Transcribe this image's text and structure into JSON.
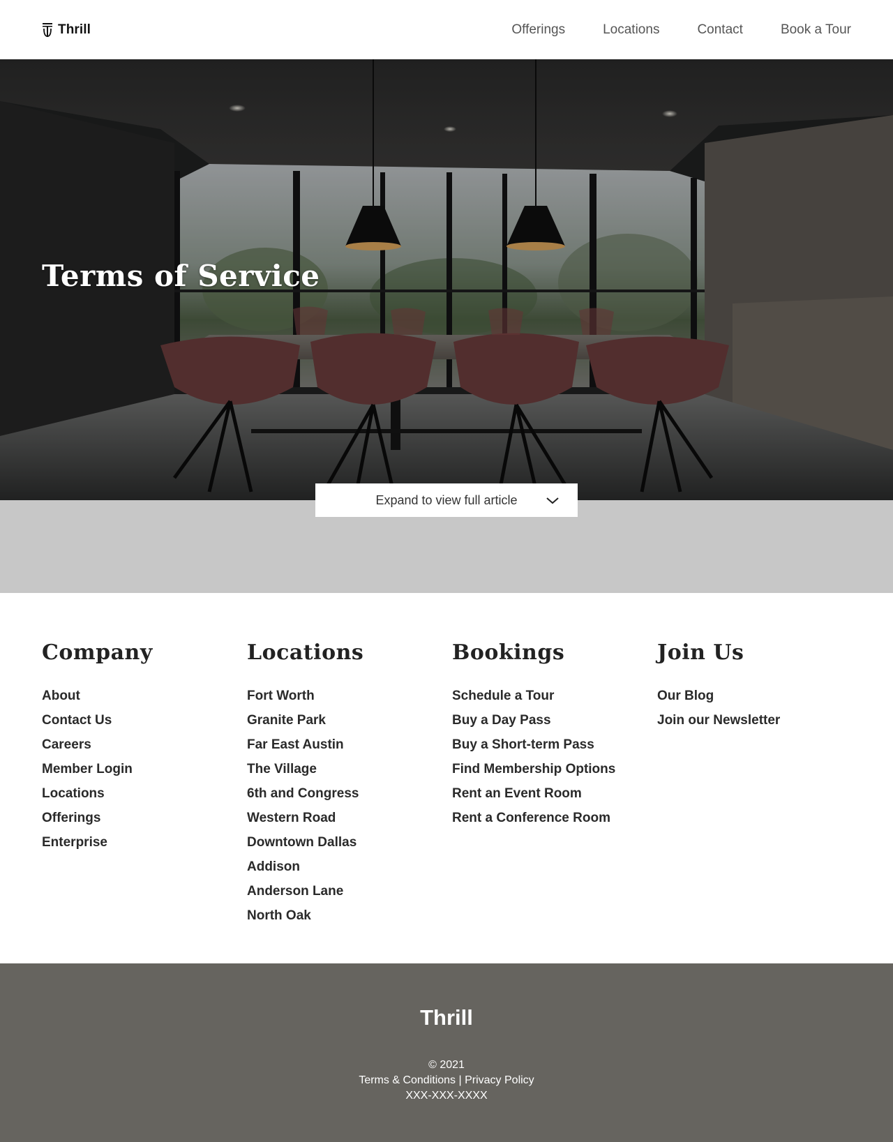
{
  "header": {
    "brand": "Thrill",
    "nav": [
      {
        "label": "Offerings"
      },
      {
        "label": "Locations"
      },
      {
        "label": "Contact"
      },
      {
        "label": "Book a Tour"
      }
    ]
  },
  "hero": {
    "title": "Terms of Service",
    "expand_label": "Expand to view full article"
  },
  "footer_columns": [
    {
      "heading": "Company",
      "items": [
        "About",
        "Contact Us",
        "Careers",
        "Member Login",
        "Locations",
        "Offerings",
        "Enterprise"
      ]
    },
    {
      "heading": "Locations",
      "items": [
        "Fort Worth",
        "Granite Park",
        "Far East Austin",
        "The Village",
        "6th and Congress",
        "Western Road",
        "Downtown Dallas",
        "Addison",
        "Anderson Lane",
        "North Oak"
      ]
    },
    {
      "heading": "Bookings",
      "items": [
        "Schedule a Tour",
        "Buy a Day Pass",
        "Buy a Short-term Pass",
        "Find Membership Options",
        "Rent an Event Room",
        "Rent a Conference Room"
      ]
    },
    {
      "heading": "Join Us",
      "items": [
        "Our Blog",
        "Join our Newsletter"
      ]
    }
  ],
  "bottom": {
    "brand": "Thrill",
    "copyright": "© 2021",
    "terms_label": "Terms & Conditions",
    "separator": " | ",
    "privacy_label": "Privacy Policy",
    "phone": "XXX-XXX-XXXX"
  },
  "colors": {
    "band_gray": "#c7c7c7",
    "footer_bg": "#66645f",
    "nav_text": "#555555"
  },
  "icons": {
    "logo": "thrill-logo-icon",
    "expand": "chevron-down-icon"
  }
}
